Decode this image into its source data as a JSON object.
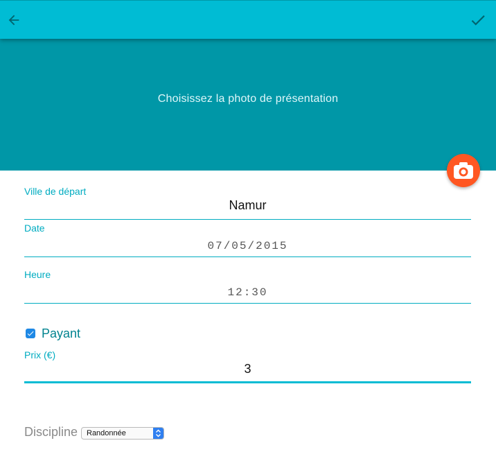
{
  "toolbar": {
    "back_icon": "arrow-left-icon",
    "confirm_icon": "check-icon",
    "background_color": "#00bcd4"
  },
  "hero": {
    "label": "Choisissez la photo de présentation",
    "background_color": "#0097a7",
    "fab_icon": "camera-icon",
    "fab_color": "#ff5722"
  },
  "form": {
    "ville": {
      "label": "Ville de départ",
      "value": "Namur"
    },
    "date": {
      "label": "Date",
      "value": "07/05/2015"
    },
    "heure": {
      "label": "Heure",
      "value": "12:30"
    },
    "payant": {
      "label": "Payant",
      "checked": true
    },
    "prix": {
      "label": "Prix (€)",
      "value": "3"
    },
    "discipline": {
      "label": "Discipline",
      "selected": "Randonnée"
    }
  },
  "accent_color": "#00acc1"
}
